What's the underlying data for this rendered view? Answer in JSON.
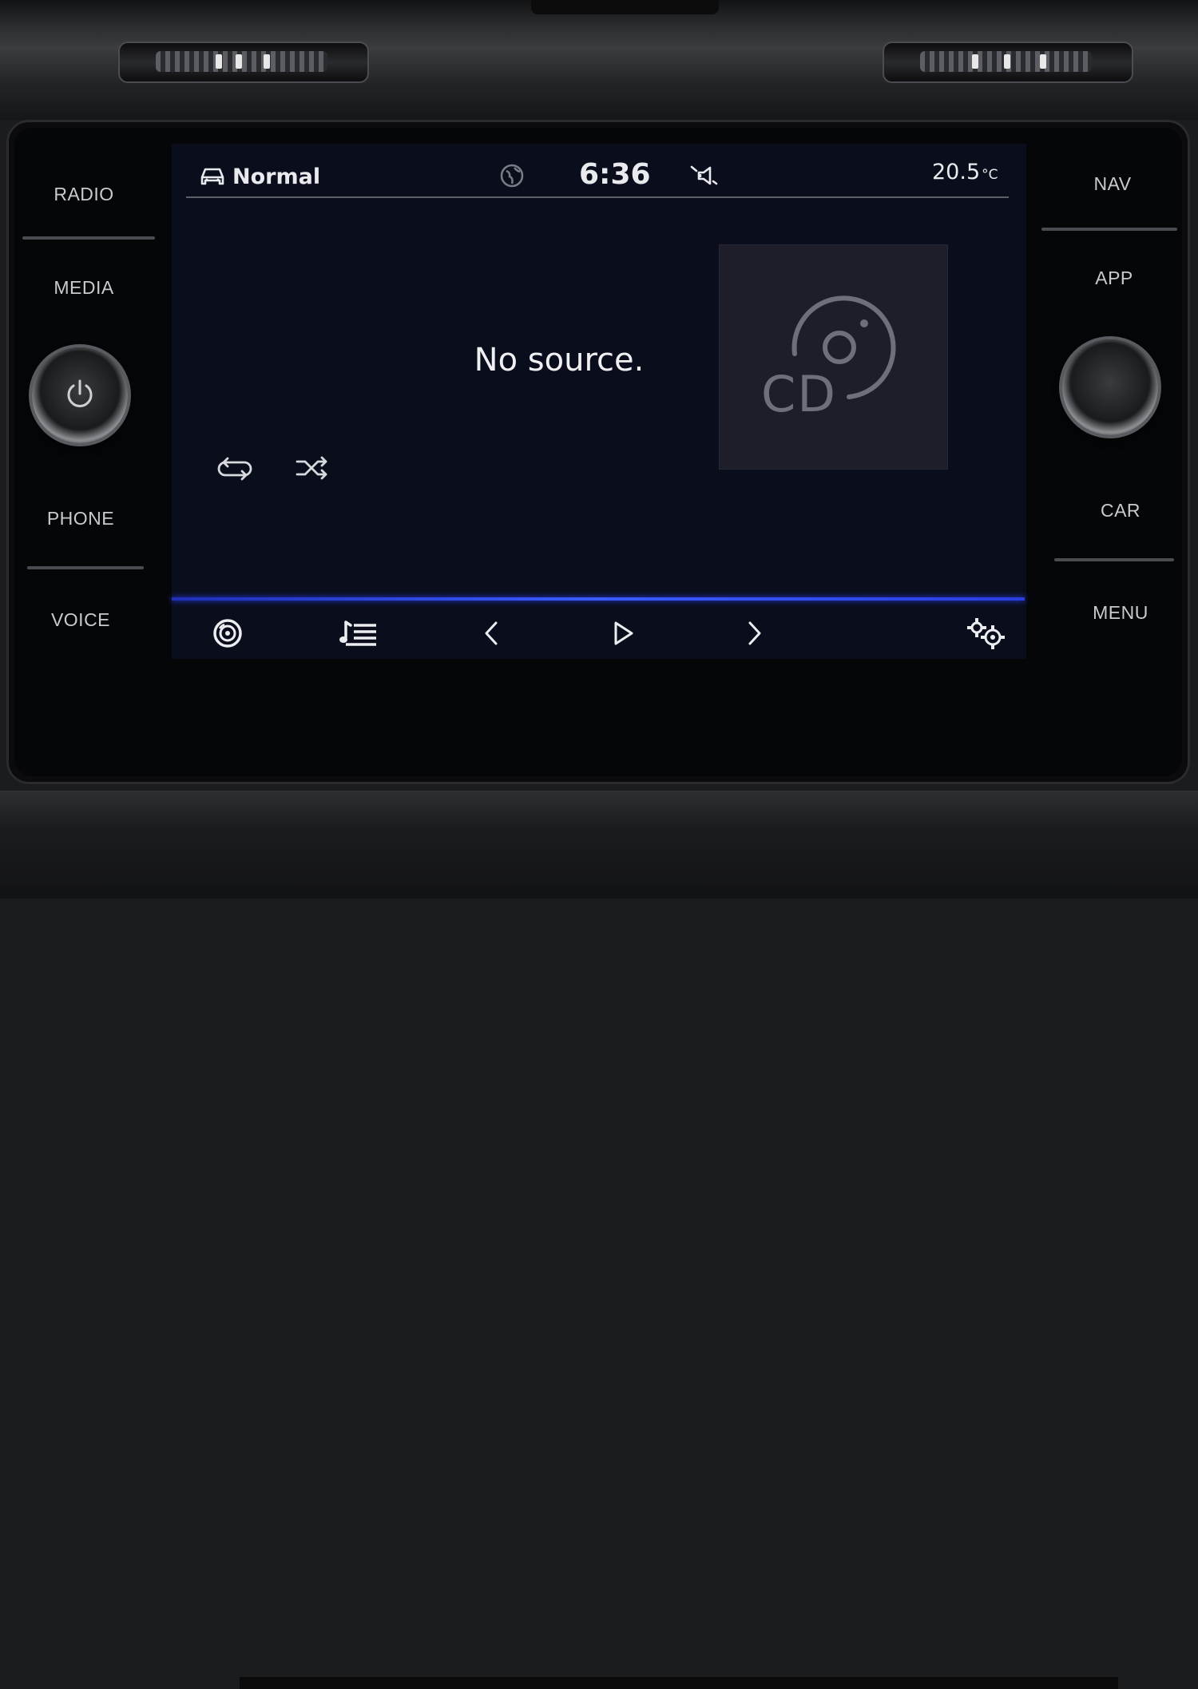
{
  "side_left": {
    "radio": "RADIO",
    "media": "MEDIA",
    "phone": "PHONE",
    "voice": "VOICE"
  },
  "side_right": {
    "nav": "NAV",
    "app": "APP",
    "car": "CAR",
    "menu": "MENU"
  },
  "status_bar": {
    "drive_profile": "Normal",
    "clock": "6:36",
    "temperature": "20.5",
    "temperature_unit": "°C",
    "icons": [
      "car-icon",
      "globe-icon",
      "mute-speaker-icon"
    ]
  },
  "media": {
    "message": "No source.",
    "album_art_label": "CD",
    "modes": [
      "repeat-icon",
      "shuffle-icon"
    ]
  },
  "controls": {
    "icons": [
      "source-disc-icon",
      "playlist-icon",
      "previous-icon",
      "play-icon",
      "next-icon",
      "settings-icon"
    ],
    "accent_color": "#3b5cff"
  }
}
